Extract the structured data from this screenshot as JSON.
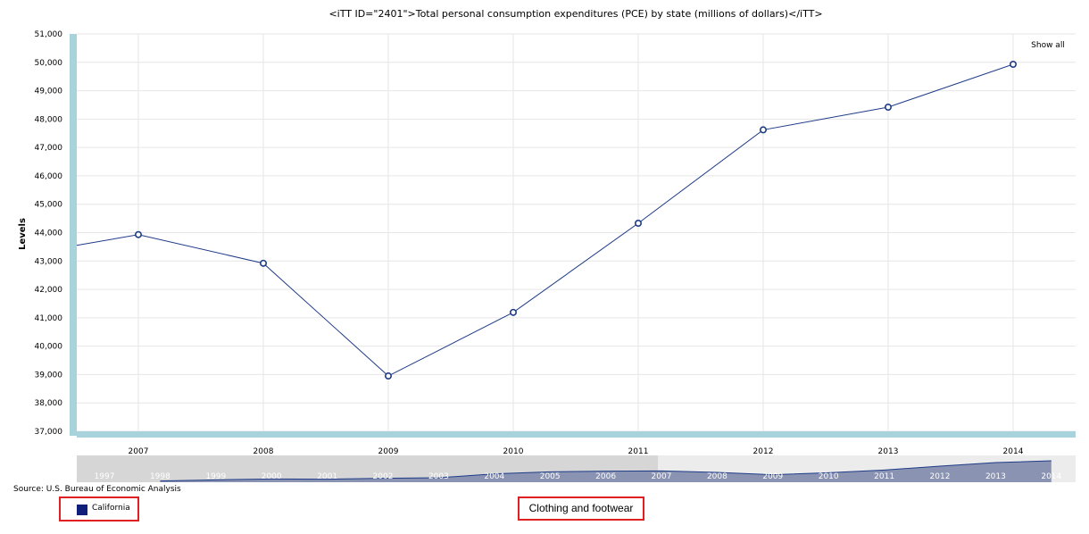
{
  "page": {
    "title": "<iTT ID=\"2401\">Total personal consumption expenditures (PCE) by state (millions of dollars)</iTT>",
    "show_all_label": "Show all",
    "source": "Source: U.S. Bureau of Economic Analysis",
    "subject_label": "Clothing and footwear"
  },
  "colors": {
    "series": "#1f3c88",
    "axis_bar": "#a9d3dc",
    "grid": "#e6e6e6",
    "legend_swatch": "#0f1f7a",
    "highlight_box": "#e02020"
  },
  "chart_data": {
    "type": "line",
    "title": "<iTT ID=\"2401\">Total personal consumption expenditures (PCE) by state (millions of dollars)</iTT>",
    "xlabel": "",
    "ylabel": "Levels",
    "ylim": [
      37000,
      51000
    ],
    "yticks": [
      37000,
      38000,
      39000,
      40000,
      41000,
      42000,
      43000,
      44000,
      45000,
      46000,
      47000,
      48000,
      49000,
      50000,
      51000
    ],
    "ytick_labels": [
      "37,000",
      "38,000",
      "39,000",
      "40,000",
      "41,000",
      "42,000",
      "43,000",
      "44,000",
      "45,000",
      "46,000",
      "47,000",
      "48,000",
      "49,000",
      "50,000",
      "51,000"
    ],
    "x": [
      "2007",
      "2008",
      "2009",
      "2010",
      "2011",
      "2012",
      "2013",
      "2014"
    ],
    "series": [
      {
        "name": "California",
        "values": [
          43930,
          42920,
          38950,
          41190,
          44330,
          47620,
          48420,
          49930
        ],
        "left_edge_value": 43550
      }
    ],
    "grid": true,
    "legend": "bottom-left",
    "navigator": {
      "years": [
        "1997",
        "1998",
        "1999",
        "2000",
        "2001",
        "2002",
        "2003",
        "2004",
        "2005",
        "2006",
        "2007",
        "2008",
        "2009",
        "2010",
        "2011",
        "2012",
        "2013",
        "2014"
      ],
      "values": [
        null,
        37400,
        37800,
        38100,
        38000,
        38300,
        38500,
        39800,
        40500,
        40700,
        40800,
        40300,
        39500,
        40200,
        41100,
        42400,
        43600,
        44200
      ],
      "selected_range": [
        "2007",
        "2014"
      ]
    }
  }
}
